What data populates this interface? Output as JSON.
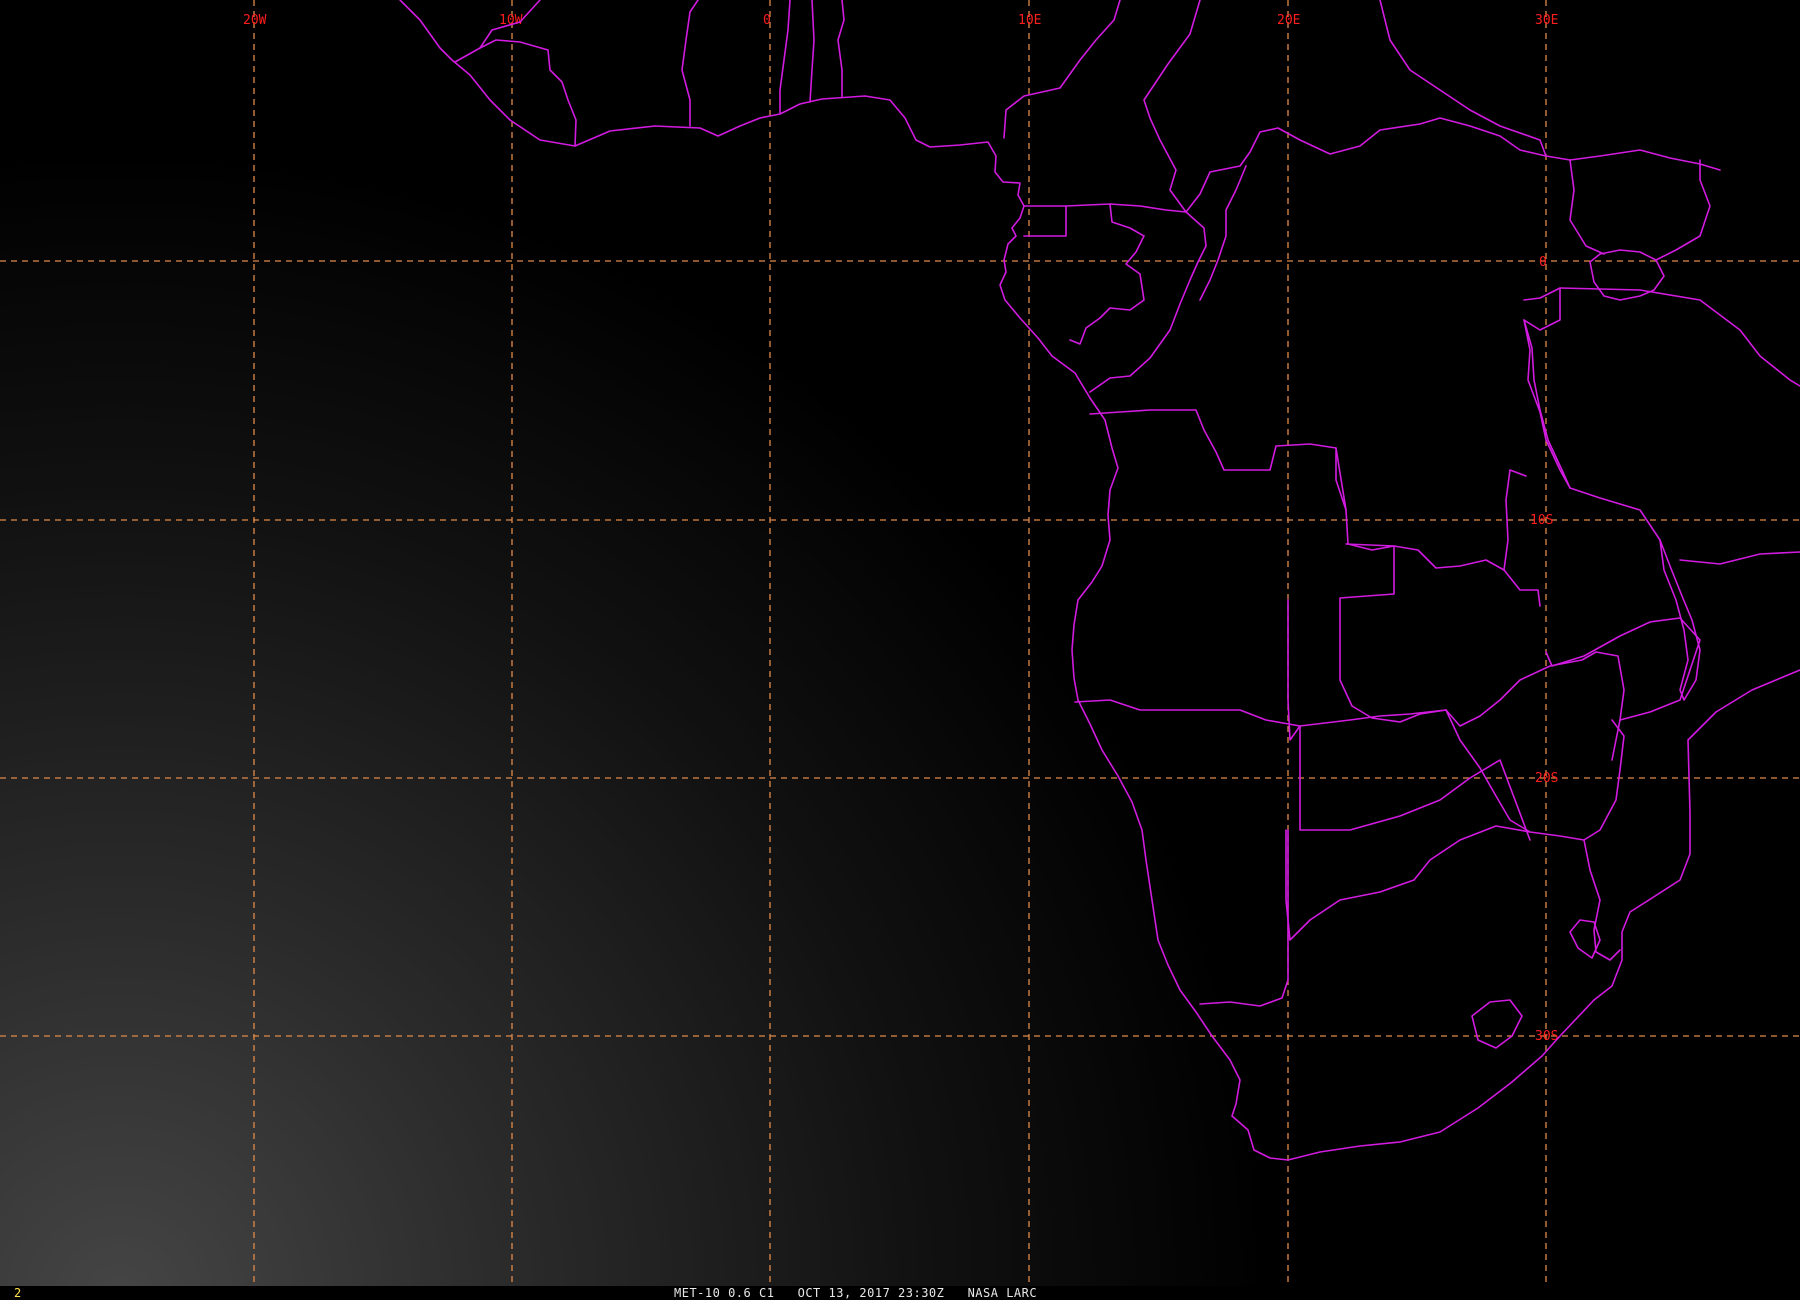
{
  "image": {
    "satellite_channel": "MET-10 0.6 C1",
    "datetime": "OCT 13, 2017 23:30Z",
    "source": "NASA LARC",
    "frame_number": "2"
  },
  "colors": {
    "background": "#000000",
    "gridlines": "#e08a4a",
    "grid_labels": "#ff1e1e",
    "boundaries": "#d21be0",
    "frame_number": "#ffe14a",
    "caption": "#e8e8e8"
  },
  "grid": {
    "longitude_labels": [
      "20W",
      "10W",
      "0",
      "10E",
      "20E",
      "30E"
    ],
    "latitude_labels": [
      "0",
      "10S",
      "20S",
      "30S"
    ]
  }
}
